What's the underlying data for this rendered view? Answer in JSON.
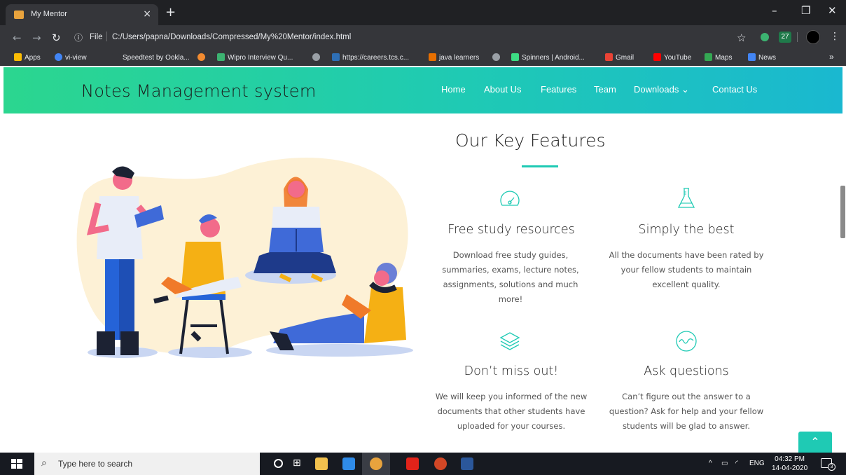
{
  "browser": {
    "tab_title": "My Mentor",
    "tab_close": "×",
    "new_tab": "+",
    "file_label": "File",
    "url": "C:/Users/papna/Downloads/Compressed/My%20Mentor/index.html",
    "extension_badge": "27",
    "bookmarks": [
      {
        "label": "Apps",
        "icon": "apps-grid-icon",
        "color": "#fbbc04"
      },
      {
        "label": "vi-view",
        "icon": "chrome-icon",
        "color": "#4285f4"
      },
      {
        "label": "Speedtest by Ookla...",
        "icon": "speedtest-icon",
        "color": "#35363a"
      },
      {
        "label": "",
        "icon": "bulb-icon",
        "color": "#f28b30"
      },
      {
        "label": "Wipro Interview Qu...",
        "icon": "wipro-icon",
        "color": "#3cb371"
      },
      {
        "label": "",
        "icon": "globe-icon",
        "color": "#9aa0a6"
      },
      {
        "label": "https://careers.tcs.c...",
        "icon": "tcs-icon",
        "color": "#2e6fb5"
      },
      {
        "label": "java learners",
        "icon": "java-icon",
        "color": "#e76f00"
      },
      {
        "label": "",
        "icon": "globe-icon",
        "color": "#9aa0a6"
      },
      {
        "label": "Spinners | Android...",
        "icon": "android-icon",
        "color": "#3ddc84"
      },
      {
        "label": "Gmail",
        "icon": "gmail-icon",
        "color": "#ea4335"
      },
      {
        "label": "YouTube",
        "icon": "youtube-icon",
        "color": "#ff0000"
      },
      {
        "label": "Maps",
        "icon": "maps-icon",
        "color": "#34a853"
      },
      {
        "label": "News",
        "icon": "news-icon",
        "color": "#4285f4"
      }
    ],
    "more_bookmarks": "»"
  },
  "site": {
    "brand": "Notes Management system",
    "nav": [
      "Home",
      "About Us",
      "Features",
      "Team",
      "Downloads",
      "Contact Us"
    ],
    "downloads_caret": "⌄",
    "accent_color": "#1fcab4"
  },
  "features": {
    "title": "Our Key Features",
    "items": [
      {
        "icon": "speedometer-icon",
        "title": "Free study resources",
        "desc": "Download free study guides, summaries, exams, lecture notes, assignments, solutions and much more!"
      },
      {
        "icon": "flask-icon",
        "title": "Simply the best",
        "desc": "All the documents have been rated by your fellow students to maintain excellent quality."
      },
      {
        "icon": "layers-icon",
        "title": "Don’t miss out!",
        "desc": "We will keep you informed of the new documents that other students have uploaded for your courses."
      },
      {
        "icon": "pulse-icon",
        "title": "Ask questions",
        "desc": "Can’t figure out the answer to a question? Ask for help and your fellow students will be glad to answer."
      }
    ]
  },
  "back_to_top": "⌃",
  "taskbar": {
    "search_placeholder": "Type here to search",
    "language": "ENG",
    "time": "04:32 PM",
    "date": "14-04-2020",
    "notification_count": "3"
  }
}
